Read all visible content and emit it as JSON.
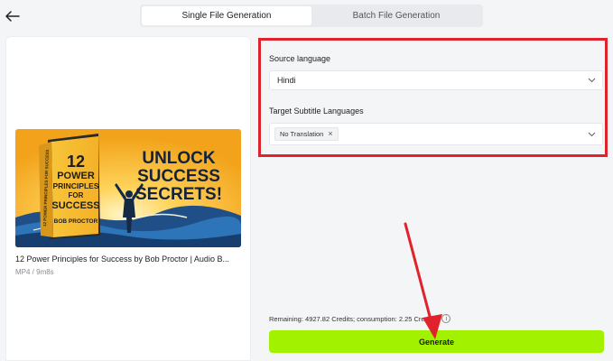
{
  "tabs": [
    {
      "label": "Single File Generation",
      "active": true
    },
    {
      "label": "Batch File Generation",
      "active": false
    }
  ],
  "video": {
    "title": "12 Power Principles for Success by Bob Proctor | Audio B...",
    "meta": "MP4 / 9m8s",
    "thumbnail": {
      "book_title_lines": [
        "12",
        "POWER",
        "PRINCIPLES",
        "FOR",
        "SUCCESS"
      ],
      "author": "BOB PROCTOR",
      "headline_lines": [
        "UNLOCK",
        "SUCCESS",
        "SECRETS!"
      ],
      "spine_text": "12 POWER PRINCIPLES FOR SUCCESS"
    }
  },
  "source_language": {
    "label": "Source language",
    "value": "Hindi"
  },
  "target_languages": {
    "label": "Target Subtitle Languages",
    "chips": [
      "No Translation"
    ]
  },
  "credits_text": "Remaining: 4927.82 Credits; consumption: 2.25 Credits",
  "generate_label": "Generate",
  "colors": {
    "accent": "#a1f100",
    "highlight": "#e0222c"
  },
  "icons": [
    "back-arrow-icon",
    "chevron-down-icon",
    "close-icon",
    "info-icon"
  ]
}
